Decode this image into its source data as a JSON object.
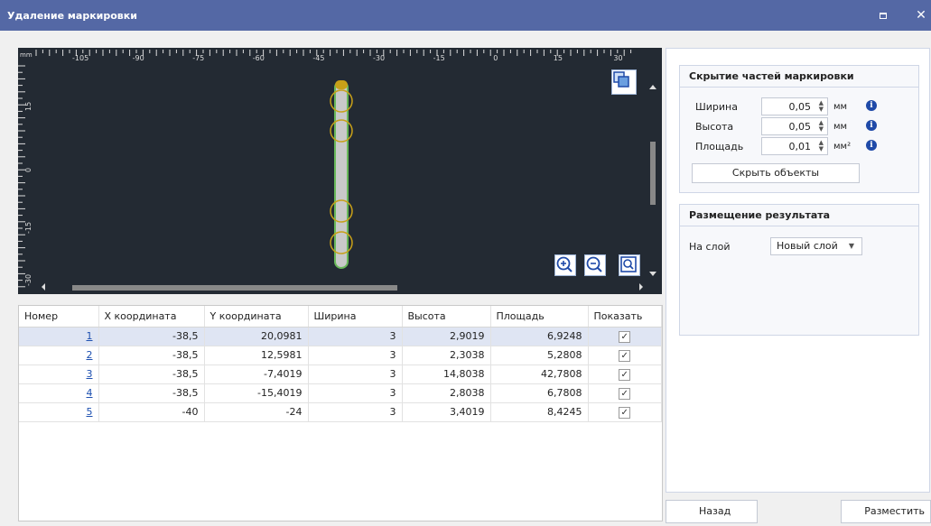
{
  "window": {
    "title": "Удаление маркировки"
  },
  "ruler": {
    "unit": "mm",
    "x_labels": [
      "-105",
      "-90",
      "-75",
      "-60",
      "-45",
      "-30",
      "-15",
      "0",
      "15",
      "30"
    ],
    "y_labels": [
      "15",
      "0",
      "-15",
      "-30"
    ]
  },
  "table": {
    "columns": [
      "Номер",
      "X координата",
      "Y координата",
      "Ширина",
      "Высота",
      "Площадь",
      "Показать"
    ],
    "rows": [
      {
        "num": "1",
        "x": "-38,5",
        "y": "20,0981",
        "w": "3",
        "h": "2,9019",
        "area": "6,9248",
        "show": "✓"
      },
      {
        "num": "2",
        "x": "-38,5",
        "y": "12,5981",
        "w": "3",
        "h": "2,3038",
        "area": "5,2808",
        "show": "✓"
      },
      {
        "num": "3",
        "x": "-38,5",
        "y": "-7,4019",
        "w": "3",
        "h": "14,8038",
        "area": "42,7808",
        "show": "✓"
      },
      {
        "num": "4",
        "x": "-38,5",
        "y": "-15,4019",
        "w": "3",
        "h": "2,8038",
        "area": "6,7808",
        "show": "✓"
      },
      {
        "num": "5",
        "x": "-40",
        "y": "-24",
        "w": "3",
        "h": "3,4019",
        "area": "8,4245",
        "show": "✓"
      }
    ]
  },
  "hide_group": {
    "title": "Скрытие частей маркировки",
    "width_label": "Ширина",
    "width_value": "0,05",
    "width_unit": "мм",
    "height_label": "Высота",
    "height_value": "0,05",
    "height_unit": "мм",
    "area_label": "Площадь",
    "area_value": "0,01",
    "area_unit": "мм²",
    "hide_button": "Скрыть объекты"
  },
  "result_group": {
    "title": "Размещение результата",
    "layer_label": "На слой",
    "layer_value": "Новый слой"
  },
  "footer": {
    "back_button": "Назад",
    "place_button": "Разместить"
  },
  "colors": {
    "titlebar": "#5468a5",
    "canvas": "#232a33",
    "marking": "#c9c9c9",
    "marker_circle": "#c8a018",
    "selected_row": "#dfe5f3"
  }
}
